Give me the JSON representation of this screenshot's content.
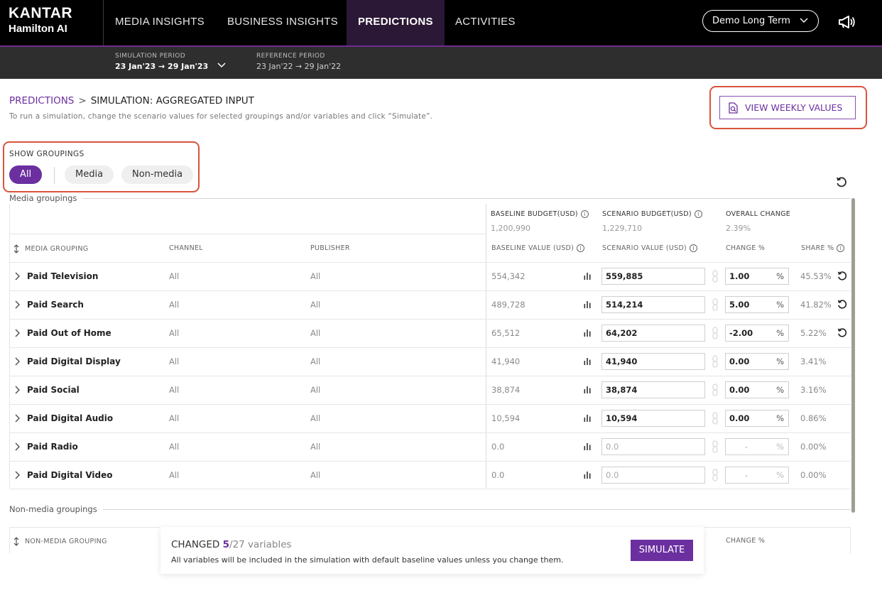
{
  "brand": {
    "line1": "KANTAR",
    "line2": "Hamilton AI"
  },
  "nav": {
    "tabs": [
      "MEDIA INSIGHTS",
      "BUSINESS INSIGHTS",
      "PREDICTIONS",
      "ACTIVITIES"
    ],
    "active": "PREDICTIONS"
  },
  "project": {
    "selected": "Demo Long Term"
  },
  "periods": {
    "simulation_label": "SIMULATION PERIOD",
    "simulation_value": "23 Jan'23 → 29 Jan'23",
    "reference_label": "REFERENCE PERIOD",
    "reference_value": "23 Jan'22 → 29 Jan'22"
  },
  "breadcrumb": {
    "root": "PREDICTIONS",
    "separator": ">",
    "current": "SIMULATION: AGGREGATED INPUT"
  },
  "help_text": "To run a simulation, change the scenario values for selected groupings and/or variables and click “Simulate”.",
  "weekly_button": "VIEW WEEKLY VALUES",
  "groupings": {
    "label": "SHOW GROUPINGS",
    "options": [
      "All",
      "Media",
      "Non-media"
    ],
    "active": "All"
  },
  "media_section": {
    "title": "Media groupings",
    "baseline_budget_label": "BASELINE BUDGET(USD)",
    "baseline_budget_value": "1,200,990",
    "scenario_budget_label": "SCENARIO BUDGET(USD)",
    "scenario_budget_value": "1,229,710",
    "overall_change_label": "OVERALL CHANGE",
    "overall_change_value": "2.39%",
    "columns": {
      "grouping": "MEDIA GROUPING",
      "channel": "CHANNEL",
      "publisher": "PUBLISHER",
      "baseline": "BASELINE VALUE (USD)",
      "scenario": "SCENARIO VALUE (USD)",
      "change": "CHANGE %",
      "share": "SHARE %"
    },
    "rows": [
      {
        "name": "Paid Television",
        "channel": "All",
        "publisher": "All",
        "baseline": "554,342",
        "scenario": "559,885",
        "change": "1.00",
        "share": "45.53%",
        "reset": true,
        "disabled": false
      },
      {
        "name": "Paid Search",
        "channel": "All",
        "publisher": "All",
        "baseline": "489,728",
        "scenario": "514,214",
        "change": "5.00",
        "share": "41.82%",
        "reset": true,
        "disabled": false
      },
      {
        "name": "Paid Out of Home",
        "channel": "All",
        "publisher": "All",
        "baseline": "65,512",
        "scenario": "64,202",
        "change": "-2.00",
        "share": "5.22%",
        "reset": true,
        "disabled": false
      },
      {
        "name": "Paid Digital Display",
        "channel": "All",
        "publisher": "All",
        "baseline": "41,940",
        "scenario": "41,940",
        "change": "0.00",
        "share": "3.41%",
        "reset": false,
        "disabled": false
      },
      {
        "name": "Paid Social",
        "channel": "All",
        "publisher": "All",
        "baseline": "38,874",
        "scenario": "38,874",
        "change": "0.00",
        "share": "3.16%",
        "reset": false,
        "disabled": false
      },
      {
        "name": "Paid Digital Audio",
        "channel": "All",
        "publisher": "All",
        "baseline": "10,594",
        "scenario": "10,594",
        "change": "0.00",
        "share": "0.86%",
        "reset": false,
        "disabled": false
      },
      {
        "name": "Paid Radio",
        "channel": "All",
        "publisher": "All",
        "baseline": "0.0",
        "scenario": "0.0",
        "change": "-",
        "share": "0.00%",
        "reset": false,
        "disabled": true
      },
      {
        "name": "Paid Digital Video",
        "channel": "All",
        "publisher": "All",
        "baseline": "0.0",
        "scenario": "0.0",
        "change": "-",
        "share": "0.00%",
        "reset": false,
        "disabled": true
      }
    ],
    "pct_symbol": "%"
  },
  "nonmedia_section": {
    "title": "Non-media groupings",
    "col_grouping": "NON-MEDIA GROUPING",
    "col_change": "CHANGE %"
  },
  "simulate_bar": {
    "changed_label": "CHANGED",
    "changed_count": "5",
    "total": "/27 variables",
    "note": "All variables will be included in the simulation with default baseline values unless you change them.",
    "button": "SIMULATE"
  },
  "colors": {
    "accent": "#6b2fa0",
    "highlight": "#d9533d",
    "nav_bg": "#000000"
  }
}
